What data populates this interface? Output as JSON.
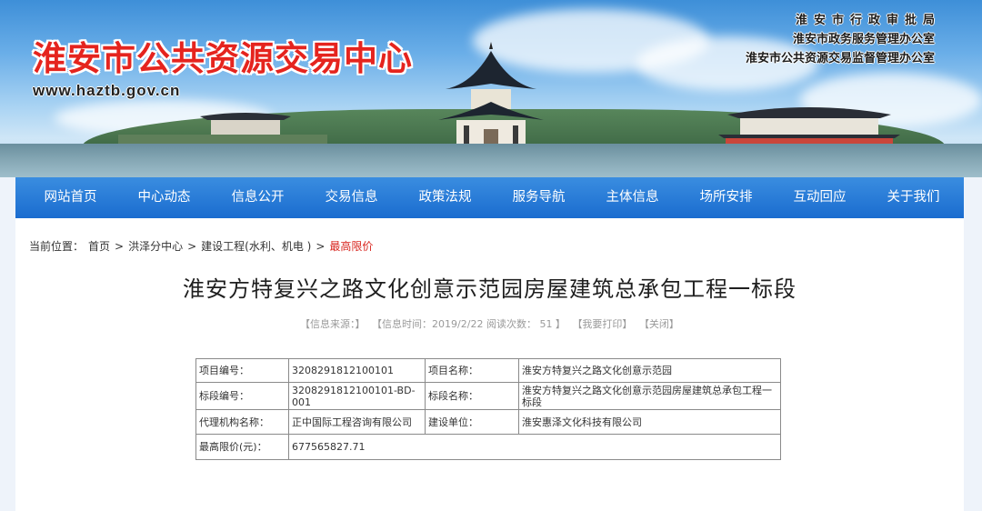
{
  "header": {
    "site_title": "淮安市公共资源交易中心",
    "url": "www.haztb.gov.cn",
    "orgs": [
      "淮安市行政审批局",
      "淮安市政务服务管理办公室",
      "淮安市公共资源交易监督管理办公室"
    ]
  },
  "nav": {
    "items": [
      "网站首页",
      "中心动态",
      "信息公开",
      "交易信息",
      "政策法规",
      "服务导航",
      "主体信息",
      "场所安排",
      "互动回应",
      "关于我们"
    ]
  },
  "breadcrumb": {
    "prefix": "当前位置：",
    "items": [
      "首页",
      "洪泽分中心",
      "建设工程(水利、机电 )"
    ],
    "current": "最高限价"
  },
  "article": {
    "title": "淮安方特复兴之路文化创意示范园房屋建筑总承包工程一标段",
    "meta": {
      "source": "【信息来源：】",
      "time": "【信息时间：2019/2/22 阅读次数： 51 】",
      "print": "【我要打印】",
      "close": "【关闭】"
    }
  },
  "info_table": {
    "rows": [
      {
        "label1": "项目编号：",
        "value1": "3208291812100101",
        "label2": "项目名称：",
        "value2": "淮安方特复兴之路文化创意示范园"
      },
      {
        "label1": "标段编号：",
        "value1": "3208291812100101-BD-001",
        "label2": "标段名称：",
        "value2": "淮安方特复兴之路文化创意示范园房屋建筑总承包工程一标段"
      },
      {
        "label1": "代理机构名称：",
        "value1": "正中国际工程咨询有限公司",
        "label2": "建设单位：",
        "value2": "淮安惠泽文化科技有限公司"
      },
      {
        "label1": "最高限价(元)：",
        "value1": "677565827.71"
      }
    ]
  },
  "colors": {
    "title_red": "#e5241e",
    "nav_blue": "#1a6ccf",
    "current_crumb": "#d8261f"
  }
}
